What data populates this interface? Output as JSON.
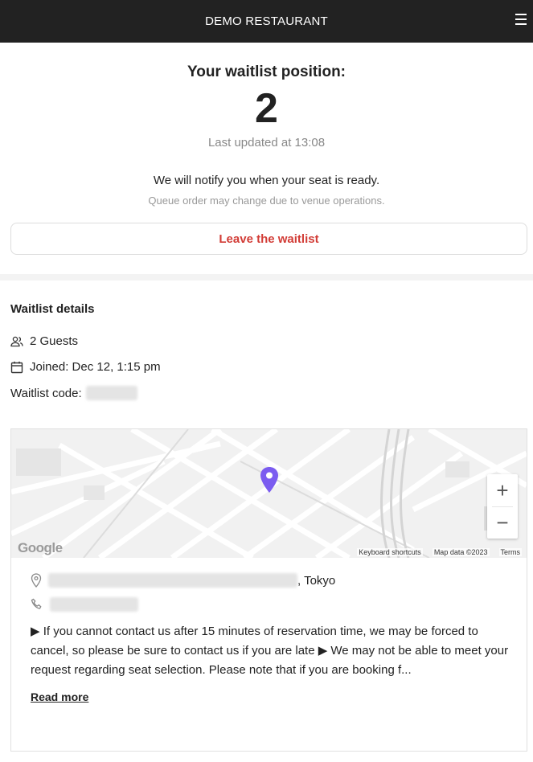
{
  "header": {
    "title": "DEMO RESTAURANT",
    "menu_icon": "hamburger-icon"
  },
  "status": {
    "position_label": "Your waitlist position:",
    "position": "2",
    "last_updated": "Last updated at 13:08",
    "notify_text": "We will notify you when your seat is ready.",
    "queue_note": "Queue order may change due to venue operations.",
    "leave_label": "Leave the waitlist"
  },
  "details": {
    "title": "Waitlist details",
    "guests": "2 Guests",
    "guests_icon": "guests-icon",
    "joined": "Joined: Dec 12, 1:15 pm",
    "joined_icon": "calendar-icon",
    "code_label": "Waitlist code:"
  },
  "map": {
    "logo": "Google",
    "keyboard_shortcuts": "Keyboard shortcuts",
    "map_data": "Map data ©2023",
    "terms": "Terms",
    "zoom_in": "+",
    "zoom_out": "−",
    "pin_color": "#7b5cf0"
  },
  "venue": {
    "address_suffix": ", Tokyo",
    "address_icon": "location-pin-icon",
    "phone_icon": "phone-icon",
    "description": "▶ If you cannot contact us after 15 minutes of reservation time, we may be forced to cancel, so please be sure to contact us if you are late ▶ We may not be able to meet your request regarding seat selection. Please note that if you are booking f...",
    "read_more": "Read more"
  },
  "colors": {
    "header_bg": "#222222",
    "leave_text": "#d23c36",
    "muted": "#888888"
  }
}
